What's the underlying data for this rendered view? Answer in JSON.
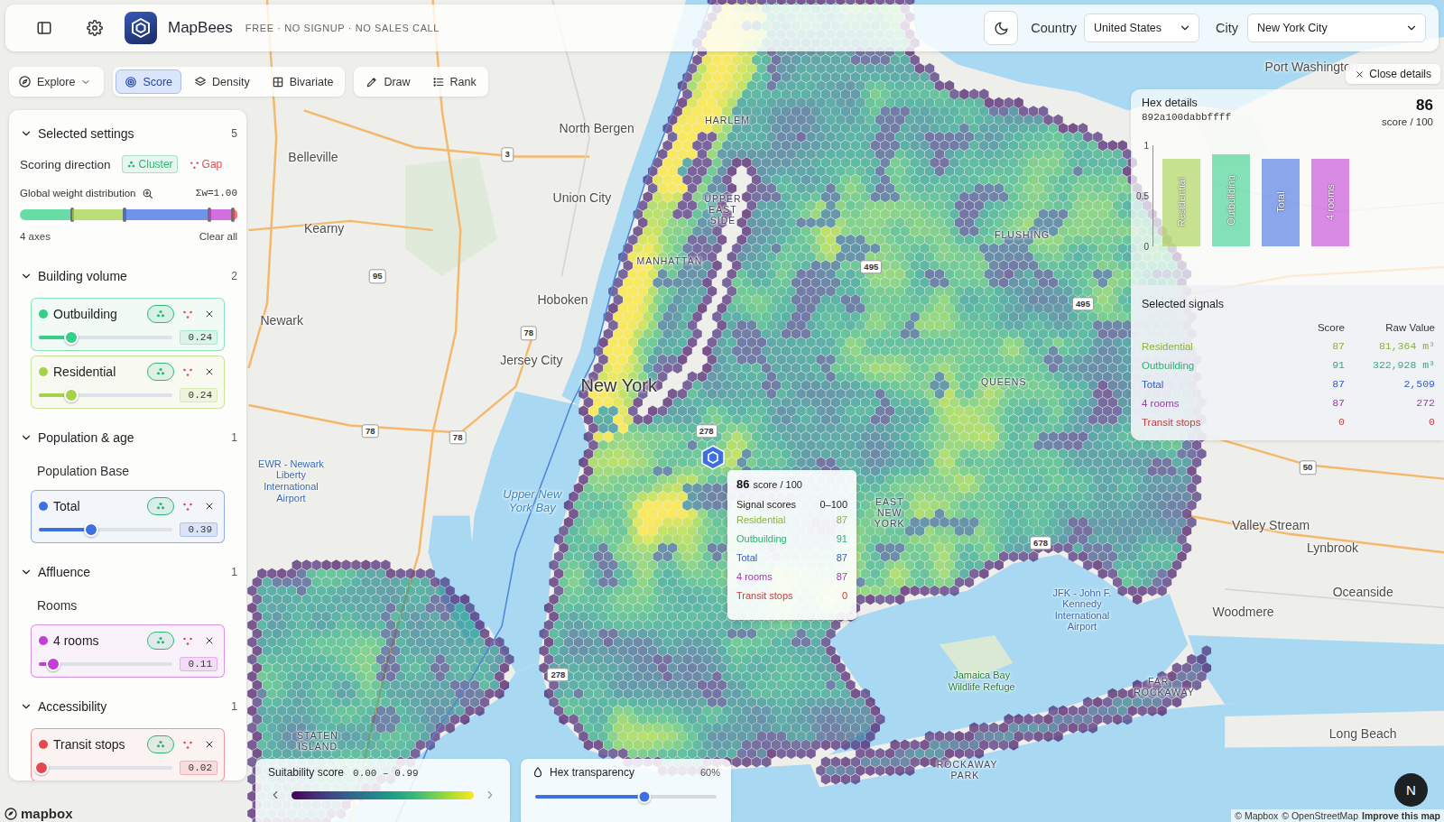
{
  "app": {
    "name": "MapBees",
    "tagline": "FREE · NO SIGNUP · NO SALES CALL"
  },
  "location": {
    "country_label": "Country",
    "country": "United States",
    "city_label": "City",
    "city": "New York City"
  },
  "toolbar": {
    "explore": "Explore",
    "modes": [
      {
        "label": "Score",
        "selected": true
      },
      {
        "label": "Density",
        "selected": false
      },
      {
        "label": "Bivariate",
        "selected": false
      }
    ],
    "tools": [
      {
        "label": "Draw",
        "selected": false
      },
      {
        "label": "Rank",
        "selected": false
      }
    ]
  },
  "settings": {
    "title": "Selected settings",
    "expanded": true,
    "count": "5",
    "direction_label": "Scoring direction",
    "directions": [
      {
        "label": "Cluster",
        "selected": true,
        "color": "#2bb673"
      },
      {
        "label": "Gap",
        "selected": false,
        "color": "#e5484d"
      }
    ],
    "weights_label": "Global weight distribution",
    "weights_sum": "Σw=1.00",
    "axes": "4 axes",
    "clear": "Clear all",
    "groups": [
      {
        "title": "Building volume",
        "count": "2",
        "expanded": true,
        "items": [
          {
            "name": "Outbuilding",
            "value": "0.24",
            "level": 0.24,
            "color": "#34d08a",
            "cluster": true
          },
          {
            "name": "Residential",
            "value": "0.24",
            "level": 0.24,
            "color": "#a4d24a",
            "cluster": true
          }
        ]
      },
      {
        "title": "Population & age",
        "count": "1",
        "expanded": true,
        "subtitle": "Population Base",
        "items": [
          {
            "name": "Total",
            "value": "0.39",
            "level": 0.39,
            "color": "#3d6fe0",
            "cluster": true
          }
        ]
      },
      {
        "title": "Affluence",
        "count": "1",
        "expanded": true,
        "subtitle": "Rooms",
        "items": [
          {
            "name": "4 rooms",
            "value": "0.11",
            "level": 0.11,
            "color": "#c23fd6",
            "cluster": true
          }
        ]
      },
      {
        "title": "Accessibility",
        "count": "1",
        "expanded": true,
        "items": [
          {
            "name": "Transit stops",
            "value": "0.02",
            "level": 0.02,
            "color": "#e5484d",
            "cluster": true
          }
        ]
      }
    ]
  },
  "hex_details": {
    "close": "Close details",
    "title": "Hex details",
    "id": "892a100dabbffff",
    "score": "86",
    "score_suffix": "score / 100",
    "chart": {
      "ticks": [
        "1",
        "0.5",
        "0"
      ],
      "bars": [
        {
          "label": "Residential",
          "value": 0.87,
          "color": "#a4d24a"
        },
        {
          "label": "Outbuilding",
          "value": 0.91,
          "color": "#34d08a"
        },
        {
          "label": "Total",
          "value": 0.87,
          "color": "#3d6fe0"
        },
        {
          "label": "4 rooms",
          "value": 0.87,
          "color": "#c23fd6"
        }
      ]
    },
    "signals_title": "Selected signals",
    "columns": [
      "Score",
      "Raw Value"
    ],
    "rows": [
      {
        "name": "Residential",
        "score": "87",
        "raw": "81,364 m³",
        "color": "#a4d24a"
      },
      {
        "name": "Outbuilding",
        "score": "91",
        "raw": "322,928 m³",
        "color": "#34d08a"
      },
      {
        "name": "Total",
        "score": "87",
        "raw": "2,509",
        "color": "#3d6fe0"
      },
      {
        "name": "4 rooms",
        "score": "87",
        "raw": "272",
        "color": "#c23fd6"
      },
      {
        "name": "Transit stops",
        "score": "0",
        "raw": "0",
        "color": "#e5484d"
      }
    ]
  },
  "tooltip": {
    "score": "86",
    "score_suffix": "score / 100",
    "heading": "Signal scores",
    "range": "0–100",
    "rows": [
      {
        "name": "Residential",
        "score": "87",
        "color": "#a4d24a"
      },
      {
        "name": "Outbuilding",
        "score": "91",
        "color": "#34d08a"
      },
      {
        "name": "Total",
        "score": "87",
        "color": "#3d6fe0"
      },
      {
        "name": "4 rooms",
        "score": "87",
        "color": "#c23fd6"
      },
      {
        "name": "Transit stops",
        "score": "0",
        "color": "#e5484d"
      }
    ]
  },
  "legend": {
    "title": "Suitability score",
    "range": "0.00 – 0.99"
  },
  "transparency": {
    "label": "Hex transparency",
    "value": "60%",
    "level": 0.6
  },
  "map": {
    "labels": [
      {
        "text": "Port Washington",
        "kind": "place"
      },
      {
        "text": "North Bergen",
        "kind": "place"
      },
      {
        "text": "Union City",
        "kind": "place"
      },
      {
        "text": "Belleville",
        "kind": "place"
      },
      {
        "text": "Kearny",
        "kind": "place"
      },
      {
        "text": "Hoboken",
        "kind": "place"
      },
      {
        "text": "Jersey City",
        "kind": "place"
      },
      {
        "text": "Newark",
        "kind": "place"
      },
      {
        "text": "New York",
        "kind": "major"
      },
      {
        "text": "Upper New York Bay",
        "kind": "water"
      },
      {
        "text": "HARLEM",
        "kind": "district"
      },
      {
        "text": "UPPER EAST SIDE",
        "kind": "district"
      },
      {
        "text": "MANHATTAN",
        "kind": "district"
      },
      {
        "text": "FLUSHING",
        "kind": "district"
      },
      {
        "text": "QUEENS",
        "kind": "district"
      },
      {
        "text": "EAST NEW YORK",
        "kind": "district"
      },
      {
        "text": "Valley Stream",
        "kind": "place"
      },
      {
        "text": "Lynbrook",
        "kind": "place"
      },
      {
        "text": "Woodmere",
        "kind": "place"
      },
      {
        "text": "Oceanside",
        "kind": "place"
      },
      {
        "text": "Long Beach",
        "kind": "place"
      },
      {
        "text": "STATEN ISLAND",
        "kind": "district"
      },
      {
        "text": "Jamaica Bay Wildlife Refuge",
        "kind": "park"
      },
      {
        "text": "JFK - John F. Kennedy International Airport",
        "kind": "poi"
      },
      {
        "text": "FAR ROCKAWAY",
        "kind": "district"
      },
      {
        "text": "ROCKAWAY PARK",
        "kind": "district"
      },
      {
        "text": "EWR - Newark Liberty International Airport",
        "kind": "poi"
      }
    ],
    "shields": [
      {
        "text": "95"
      },
      {
        "text": "78"
      },
      {
        "text": "78"
      },
      {
        "text": "78"
      },
      {
        "text": "3"
      },
      {
        "text": "278"
      },
      {
        "text": "495"
      },
      {
        "text": "495"
      },
      {
        "text": "678"
      },
      {
        "text": "278"
      },
      {
        "text": "50"
      }
    ],
    "logo": "mapbox",
    "attribution": [
      "© Mapbox",
      "© OpenStreetMap",
      "Improve this map"
    ]
  },
  "user": {
    "initial": "N"
  }
}
